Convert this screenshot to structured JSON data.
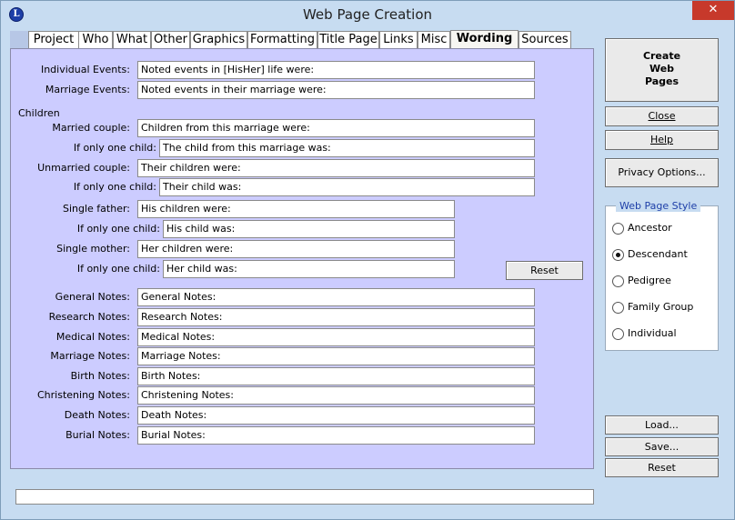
{
  "window": {
    "title": "Web Page Creation",
    "icon": "L"
  },
  "tabs": [
    {
      "label": "Project"
    },
    {
      "label": "Who"
    },
    {
      "label": "What"
    },
    {
      "label": "Other"
    },
    {
      "label": "Graphics"
    },
    {
      "label": "Formatting"
    },
    {
      "label": "Title Page"
    },
    {
      "label": "Links"
    },
    {
      "label": "Misc"
    },
    {
      "label": "Wording",
      "active": true
    },
    {
      "label": "Sources"
    }
  ],
  "events": {
    "individual_label": "Individual Events:",
    "individual_value": "Noted events in [HisHer] life were:",
    "marriage_label": "Marriage Events:",
    "marriage_value": "Noted events in their marriage were:"
  },
  "children": {
    "section_label": "Children",
    "married_label": "Married couple:",
    "married_value": "Children from this marriage were:",
    "married_one_label": "If only one child:",
    "married_one_value": "The child from this marriage was:",
    "unmarried_label": "Unmarried couple:",
    "unmarried_value": "Their children were:",
    "unmarried_one_label": "If only one child:",
    "unmarried_one_value": "Their child was:",
    "father_label": "Single father:",
    "father_value": "His children were:",
    "father_one_label": "If only one child:",
    "father_one_value": "His child was:",
    "mother_label": "Single mother:",
    "mother_value": "Her children were:",
    "mother_one_label": "If only one child:",
    "mother_one_value": "Her child was:",
    "reset_label": "Reset"
  },
  "notes": [
    {
      "label": "General Notes:",
      "value": "General Notes:"
    },
    {
      "label": "Research Notes:",
      "value": "Research Notes:"
    },
    {
      "label": "Medical Notes:",
      "value": "Medical Notes:"
    },
    {
      "label": "Marriage Notes:",
      "value": "Marriage Notes:"
    },
    {
      "label": "Birth Notes:",
      "value": "Birth Notes:"
    },
    {
      "label": "Christening Notes:",
      "value": "Christening Notes:"
    },
    {
      "label": "Death Notes:",
      "value": "Death Notes:"
    },
    {
      "label": "Burial Notes:",
      "value": "Burial Notes:"
    }
  ],
  "sidebar": {
    "create_line1": "Create",
    "create_line2": "Web",
    "create_line3": "Pages",
    "close_label": "Close",
    "help_label": "Help",
    "privacy_label": "Privacy Options...",
    "style_title": "Web Page Style",
    "styles": [
      {
        "label": "Ancestor",
        "selected": false
      },
      {
        "label": "Descendant",
        "selected": true
      },
      {
        "label": "Pedigree",
        "selected": false
      },
      {
        "label": "Family Group",
        "selected": false
      },
      {
        "label": "Individual",
        "selected": false
      }
    ],
    "load_label": "Load...",
    "save_label": "Save...",
    "reset_label": "Reset"
  }
}
